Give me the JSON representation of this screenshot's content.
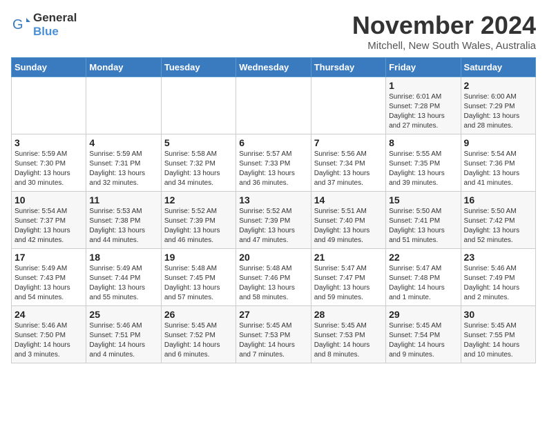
{
  "logo": {
    "general": "General",
    "blue": "Blue"
  },
  "title": "November 2024",
  "location": "Mitchell, New South Wales, Australia",
  "weekdays": [
    "Sunday",
    "Monday",
    "Tuesday",
    "Wednesday",
    "Thursday",
    "Friday",
    "Saturday"
  ],
  "weeks": [
    [
      {
        "day": "",
        "info": ""
      },
      {
        "day": "",
        "info": ""
      },
      {
        "day": "",
        "info": ""
      },
      {
        "day": "",
        "info": ""
      },
      {
        "day": "",
        "info": ""
      },
      {
        "day": "1",
        "info": "Sunrise: 6:01 AM\nSunset: 7:28 PM\nDaylight: 13 hours\nand 27 minutes."
      },
      {
        "day": "2",
        "info": "Sunrise: 6:00 AM\nSunset: 7:29 PM\nDaylight: 13 hours\nand 28 minutes."
      }
    ],
    [
      {
        "day": "3",
        "info": "Sunrise: 5:59 AM\nSunset: 7:30 PM\nDaylight: 13 hours\nand 30 minutes."
      },
      {
        "day": "4",
        "info": "Sunrise: 5:59 AM\nSunset: 7:31 PM\nDaylight: 13 hours\nand 32 minutes."
      },
      {
        "day": "5",
        "info": "Sunrise: 5:58 AM\nSunset: 7:32 PM\nDaylight: 13 hours\nand 34 minutes."
      },
      {
        "day": "6",
        "info": "Sunrise: 5:57 AM\nSunset: 7:33 PM\nDaylight: 13 hours\nand 36 minutes."
      },
      {
        "day": "7",
        "info": "Sunrise: 5:56 AM\nSunset: 7:34 PM\nDaylight: 13 hours\nand 37 minutes."
      },
      {
        "day": "8",
        "info": "Sunrise: 5:55 AM\nSunset: 7:35 PM\nDaylight: 13 hours\nand 39 minutes."
      },
      {
        "day": "9",
        "info": "Sunrise: 5:54 AM\nSunset: 7:36 PM\nDaylight: 13 hours\nand 41 minutes."
      }
    ],
    [
      {
        "day": "10",
        "info": "Sunrise: 5:54 AM\nSunset: 7:37 PM\nDaylight: 13 hours\nand 42 minutes."
      },
      {
        "day": "11",
        "info": "Sunrise: 5:53 AM\nSunset: 7:38 PM\nDaylight: 13 hours\nand 44 minutes."
      },
      {
        "day": "12",
        "info": "Sunrise: 5:52 AM\nSunset: 7:39 PM\nDaylight: 13 hours\nand 46 minutes."
      },
      {
        "day": "13",
        "info": "Sunrise: 5:52 AM\nSunset: 7:39 PM\nDaylight: 13 hours\nand 47 minutes."
      },
      {
        "day": "14",
        "info": "Sunrise: 5:51 AM\nSunset: 7:40 PM\nDaylight: 13 hours\nand 49 minutes."
      },
      {
        "day": "15",
        "info": "Sunrise: 5:50 AM\nSunset: 7:41 PM\nDaylight: 13 hours\nand 51 minutes."
      },
      {
        "day": "16",
        "info": "Sunrise: 5:50 AM\nSunset: 7:42 PM\nDaylight: 13 hours\nand 52 minutes."
      }
    ],
    [
      {
        "day": "17",
        "info": "Sunrise: 5:49 AM\nSunset: 7:43 PM\nDaylight: 13 hours\nand 54 minutes."
      },
      {
        "day": "18",
        "info": "Sunrise: 5:49 AM\nSunset: 7:44 PM\nDaylight: 13 hours\nand 55 minutes."
      },
      {
        "day": "19",
        "info": "Sunrise: 5:48 AM\nSunset: 7:45 PM\nDaylight: 13 hours\nand 57 minutes."
      },
      {
        "day": "20",
        "info": "Sunrise: 5:48 AM\nSunset: 7:46 PM\nDaylight: 13 hours\nand 58 minutes."
      },
      {
        "day": "21",
        "info": "Sunrise: 5:47 AM\nSunset: 7:47 PM\nDaylight: 13 hours\nand 59 minutes."
      },
      {
        "day": "22",
        "info": "Sunrise: 5:47 AM\nSunset: 7:48 PM\nDaylight: 14 hours\nand 1 minute."
      },
      {
        "day": "23",
        "info": "Sunrise: 5:46 AM\nSunset: 7:49 PM\nDaylight: 14 hours\nand 2 minutes."
      }
    ],
    [
      {
        "day": "24",
        "info": "Sunrise: 5:46 AM\nSunset: 7:50 PM\nDaylight: 14 hours\nand 3 minutes."
      },
      {
        "day": "25",
        "info": "Sunrise: 5:46 AM\nSunset: 7:51 PM\nDaylight: 14 hours\nand 4 minutes."
      },
      {
        "day": "26",
        "info": "Sunrise: 5:45 AM\nSunset: 7:52 PM\nDaylight: 14 hours\nand 6 minutes."
      },
      {
        "day": "27",
        "info": "Sunrise: 5:45 AM\nSunset: 7:53 PM\nDaylight: 14 hours\nand 7 minutes."
      },
      {
        "day": "28",
        "info": "Sunrise: 5:45 AM\nSunset: 7:53 PM\nDaylight: 14 hours\nand 8 minutes."
      },
      {
        "day": "29",
        "info": "Sunrise: 5:45 AM\nSunset: 7:54 PM\nDaylight: 14 hours\nand 9 minutes."
      },
      {
        "day": "30",
        "info": "Sunrise: 5:45 AM\nSunset: 7:55 PM\nDaylight: 14 hours\nand 10 minutes."
      }
    ]
  ]
}
